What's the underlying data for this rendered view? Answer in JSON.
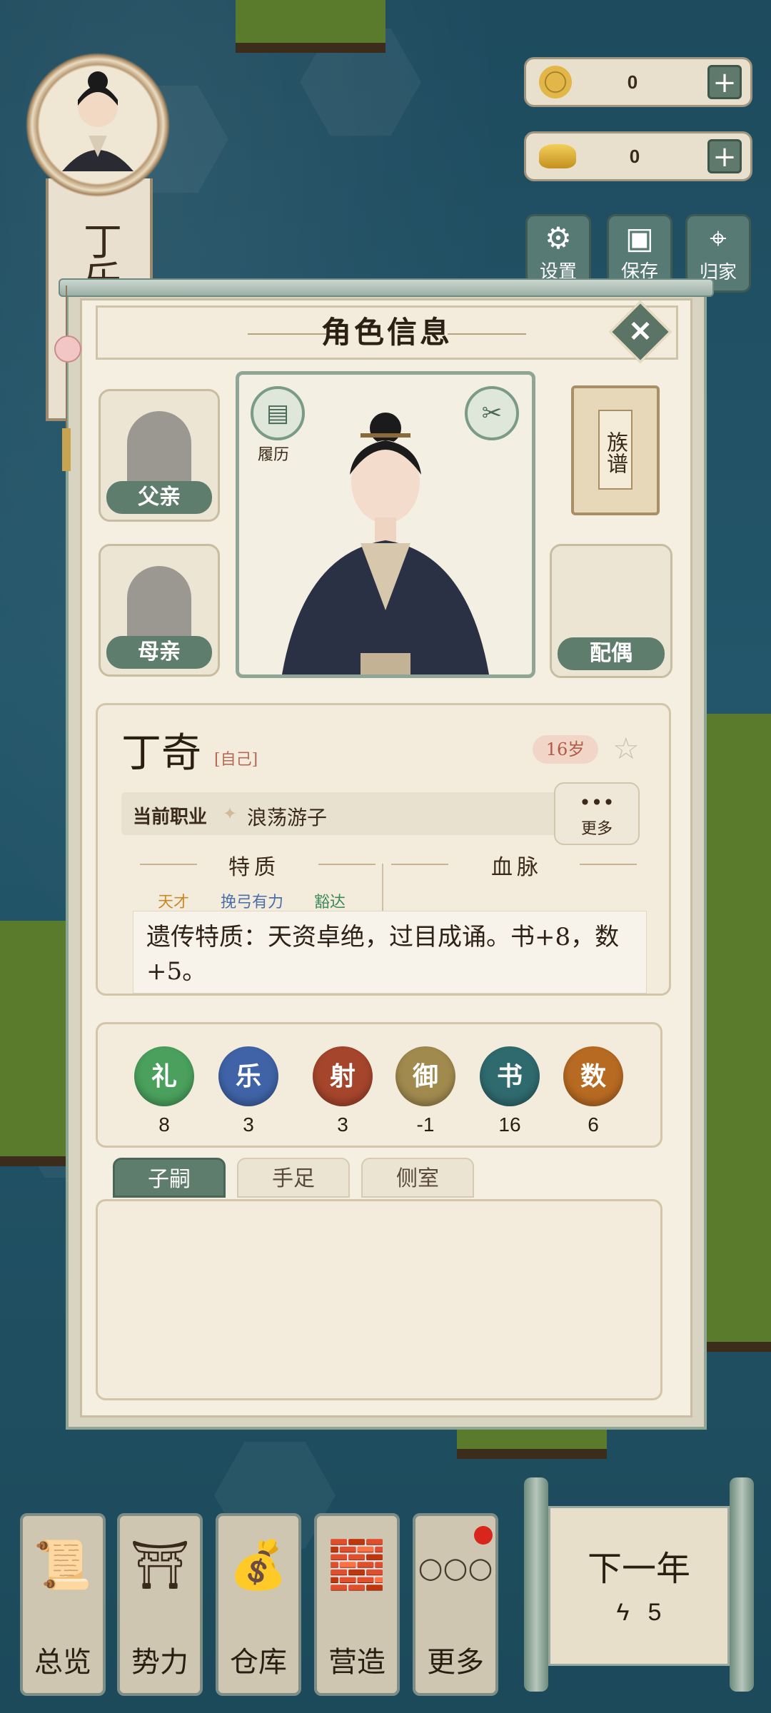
{
  "hud": {
    "character_name": "丁乐",
    "copper_coins": "0",
    "gold_ingots": "0",
    "buttons": [
      {
        "label": "设置",
        "icon": "gear-icon"
      },
      {
        "label": "保存",
        "icon": "save-icon"
      },
      {
        "label": "归家",
        "icon": "location-pin-icon"
      }
    ]
  },
  "panel": {
    "title": "角色信息",
    "father_label": "父亲",
    "mother_label": "母亲",
    "spouse_label": "配偶",
    "resume_label": "履历",
    "genealogy_label": "族谱",
    "name": "丁奇",
    "self_tag": "[自己]",
    "age": "16岁",
    "job_label": "当前职业",
    "job_value": "浪荡游子",
    "more_dots": "•••",
    "more_label": "更多",
    "traits_heading": "特质",
    "bloodline_heading": "血脉",
    "traits": [
      "天才",
      "挽弓有力",
      "豁达"
    ],
    "trait_colors": [
      "#c9892a",
      "#4a6ea8",
      "#3c8a5a"
    ],
    "description": "遗传特质：天资卓绝，过目成诵。书+8，数+5。",
    "stats": [
      {
        "name": "礼",
        "value": "8",
        "color": "#4aa05c"
      },
      {
        "name": "乐",
        "value": "3",
        "color": "#3f63a6"
      },
      {
        "name": "射",
        "value": "3",
        "color": "#a5452c"
      },
      {
        "name": "御",
        "value": "-1",
        "color": "#a08a4e"
      },
      {
        "name": "书",
        "value": "16",
        "color": "#2f6a6e"
      },
      {
        "name": "数",
        "value": "6",
        "color": "#b76a22"
      }
    ],
    "tabs": [
      "子嗣",
      "手足",
      "侧室"
    ]
  },
  "bottom_nav": [
    {
      "label": "总览",
      "icon": "scroll-brush-icon"
    },
    {
      "label": "势力",
      "icon": "palace-icon"
    },
    {
      "label": "仓库",
      "icon": "money-bag-icon"
    },
    {
      "label": "营造",
      "icon": "bricks-trowel-icon"
    },
    {
      "label": "更多",
      "icon": "more-dots-icon"
    }
  ],
  "more_glyph": "○○○",
  "next_year": {
    "label": "下一年",
    "energy": "5"
  }
}
